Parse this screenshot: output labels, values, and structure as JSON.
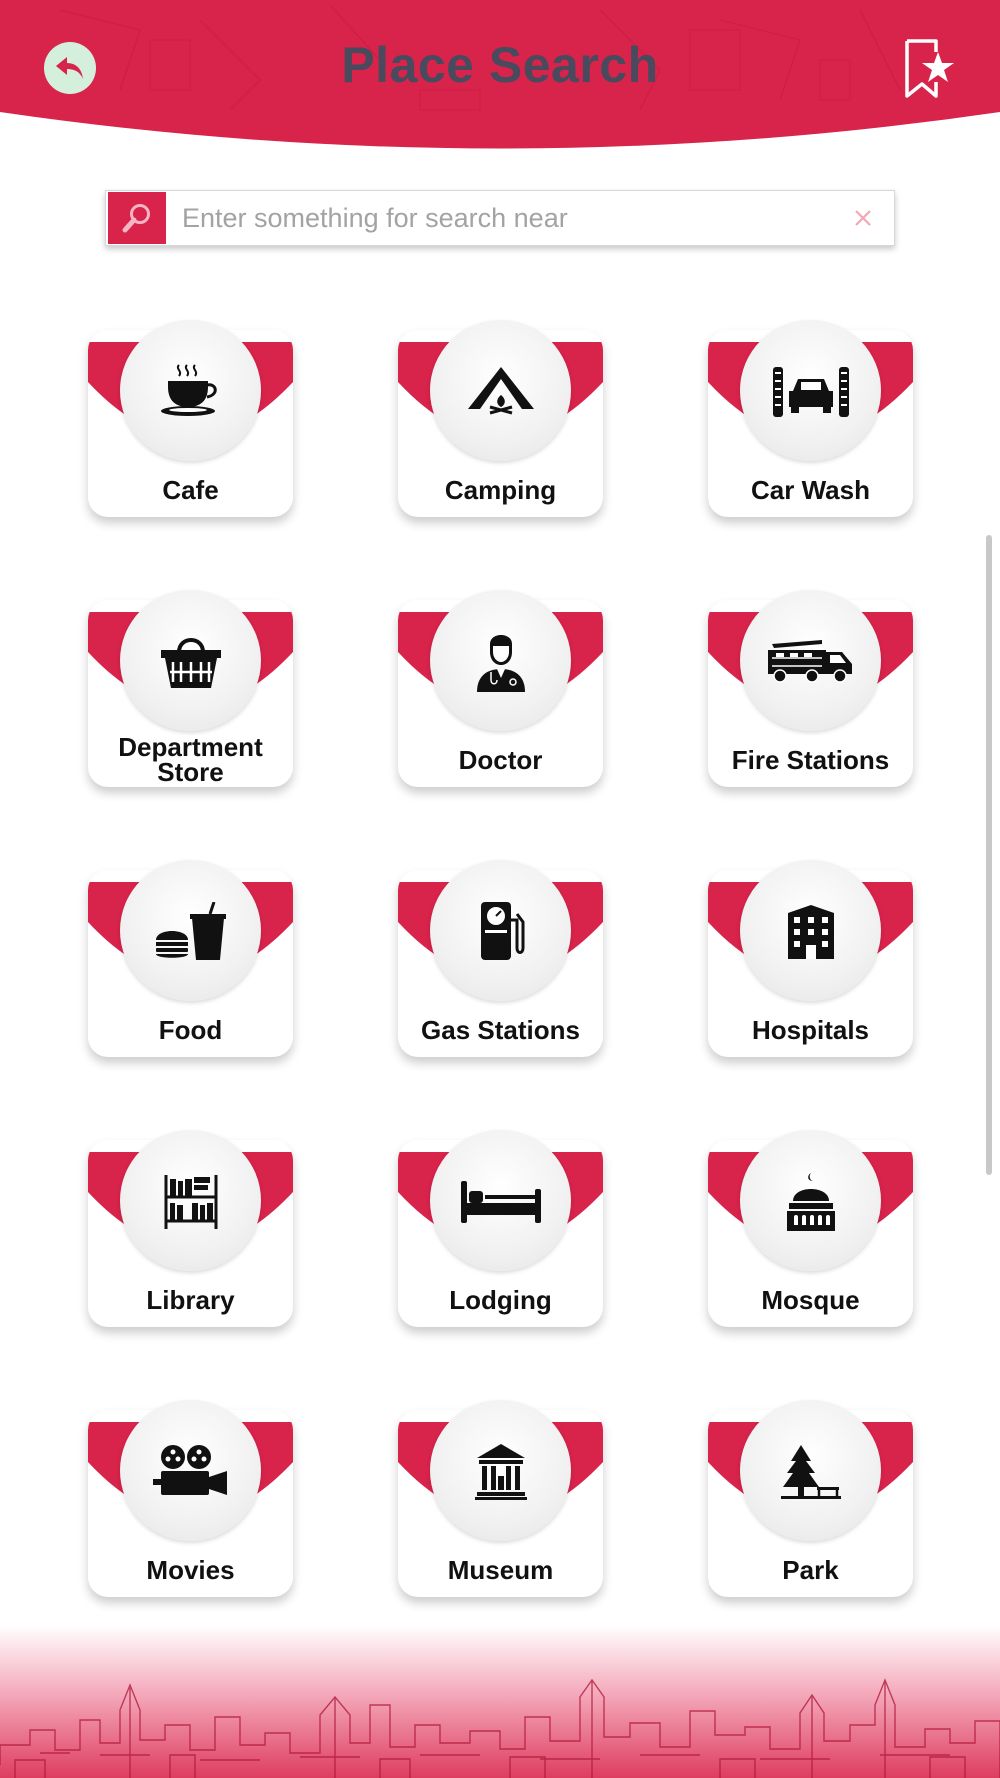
{
  "header": {
    "title": "Place Search",
    "back_icon": "back-arrow-icon",
    "favorites_icon": "bookmark-star-icon"
  },
  "search": {
    "placeholder": "Enter something for search near",
    "value": ""
  },
  "categories": [
    {
      "label": "Cafe",
      "icon": "coffee-cup-icon"
    },
    {
      "label": "Camping",
      "icon": "tent-icon"
    },
    {
      "label": "Car Wash",
      "icon": "car-wash-icon"
    },
    {
      "label": "Department Store",
      "line1": "Department",
      "line2": "Store",
      "icon": "shopping-basket-icon"
    },
    {
      "label": "Doctor",
      "icon": "doctor-icon"
    },
    {
      "label": "Fire Stations",
      "icon": "fire-truck-icon"
    },
    {
      "label": "Food",
      "icon": "burger-drink-icon"
    },
    {
      "label": "Gas Stations",
      "icon": "fuel-pump-icon"
    },
    {
      "label": "Hospitals",
      "icon": "hospital-building-icon"
    },
    {
      "label": "Library",
      "icon": "bookshelf-icon"
    },
    {
      "label": "Lodging",
      "icon": "bed-icon"
    },
    {
      "label": "Mosque",
      "icon": "mosque-icon"
    },
    {
      "label": "Movies",
      "icon": "film-camera-icon"
    },
    {
      "label": "Museum",
      "icon": "museum-icon"
    },
    {
      "label": "Park",
      "icon": "tree-bench-icon"
    }
  ],
  "colors": {
    "accent": "#d8234b",
    "title": "#4a4a5e",
    "back_button": "#d4f0dc"
  }
}
